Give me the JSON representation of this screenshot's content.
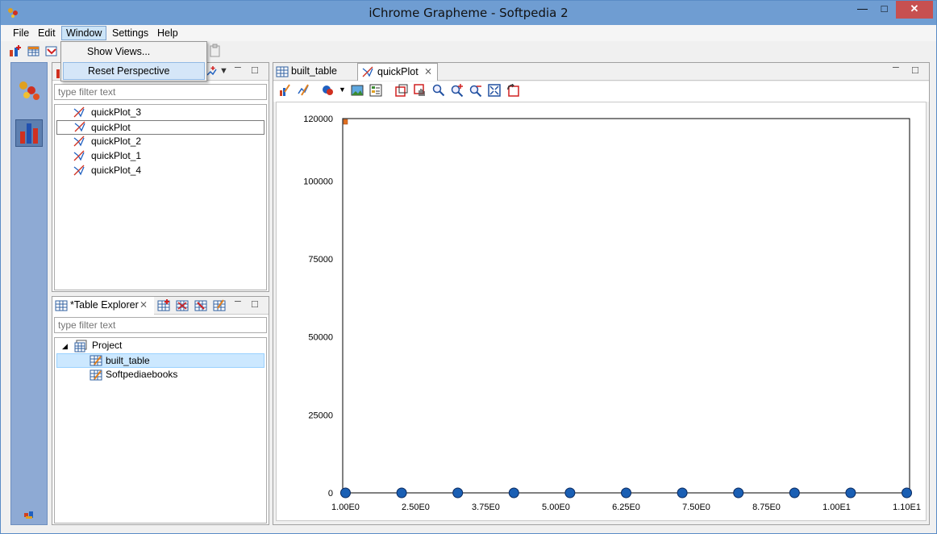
{
  "window": {
    "title": "iChrome Grapheme - Softpedia 2"
  },
  "menu": {
    "file": "File",
    "edit": "Edit",
    "window": "Window",
    "settings": "Settings",
    "help": "Help"
  },
  "window_menu": {
    "show_views": "Show Views...",
    "reset_perspective": "Reset Perspective"
  },
  "plot_explorer": {
    "filter_placeholder": "type filter text",
    "items": [
      "quickPlot_3",
      "quickPlot",
      "quickPlot_2",
      "quickPlot_1",
      "quickPlot_4"
    ],
    "selected": "quickPlot"
  },
  "table_explorer": {
    "tab_label": "*Table Explorer",
    "filter_placeholder": "type filter text",
    "project": "Project",
    "tables": [
      "built_table",
      "Softpediaebooks"
    ],
    "selected": "built_table"
  },
  "editor": {
    "tabs": [
      "built_table",
      "quickPlot"
    ],
    "active_tab": "quickPlot"
  },
  "chart_data": {
    "type": "scatter",
    "title": "",
    "xlabel": "",
    "ylabel": "",
    "xlim": [
      0.95,
      11.05
    ],
    "ylim": [
      0,
      120000
    ],
    "xticks": [
      "1.00E0",
      "2.50E0",
      "3.75E0",
      "5.00E0",
      "6.25E0",
      "7.50E0",
      "8.75E0",
      "1.00E1",
      "1.10E1"
    ],
    "xtick_values": [
      1.0,
      2.25,
      3.5,
      4.75,
      6.0,
      7.25,
      8.5,
      9.75,
      11.0
    ],
    "yticks": [
      "0",
      "25000",
      "50000",
      "75000",
      "100000",
      "120000"
    ],
    "ytick_values": [
      0,
      25000,
      50000,
      75000,
      100000,
      120000
    ],
    "grid": false,
    "marker_color": "#1a5fb4",
    "x": [
      1,
      2,
      3,
      4,
      5,
      6,
      7,
      8,
      9,
      10,
      11
    ],
    "y": [
      0,
      0,
      0,
      0,
      0,
      0,
      0,
      0,
      0,
      0,
      0
    ]
  }
}
